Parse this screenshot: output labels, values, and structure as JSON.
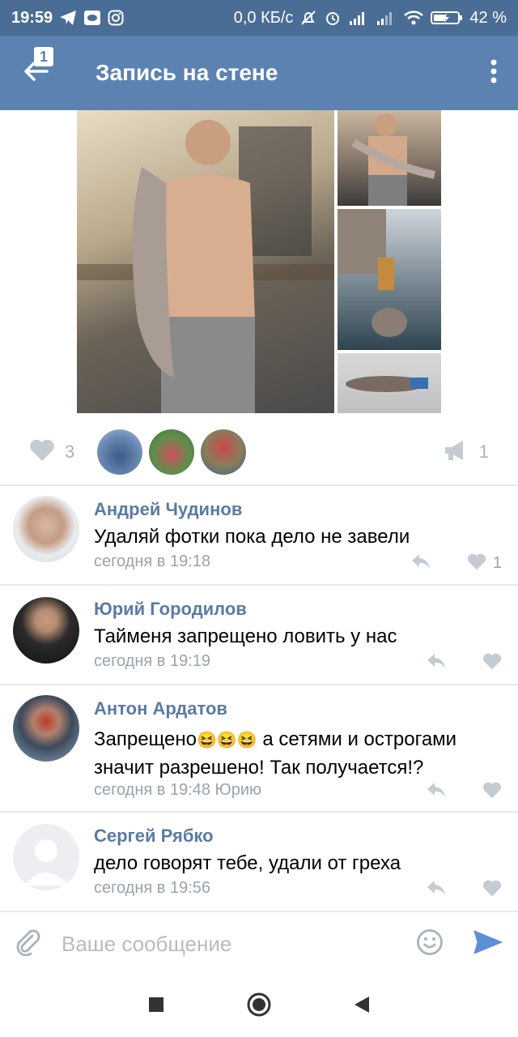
{
  "status_bar": {
    "time": "19:59",
    "network_speed": "0,0 КБ/с",
    "battery": "42 %"
  },
  "toolbar": {
    "badge": "1",
    "title": "Запись на стене"
  },
  "reactions": {
    "likes": "3",
    "shares": "1"
  },
  "comments": [
    {
      "name": "Андрей Чудинов",
      "text": "Удаляй фотки пока дело не завели",
      "time": "сегодня в 19:18",
      "likes": "1"
    },
    {
      "name": "Юрий Городилов",
      "text": "Тайменя запрещено ловить у нас",
      "time": "сегодня в 19:19",
      "likes": ""
    },
    {
      "name": "Антон Ардатов",
      "text_line1": "Запрещено",
      "text_emoji": "😆😆😆",
      "text_line1_tail": " а сетями и острогами",
      "text_line2": "значит разрешено! Так получается!?",
      "time": "сегодня в 19:48 Юрию",
      "likes": ""
    },
    {
      "name": "Сергей Рябко",
      "text": "дело говорят тебе, удали от греха",
      "time": "сегодня в 19:56",
      "likes": ""
    }
  ],
  "composer": {
    "placeholder": "Ваше сообщение"
  },
  "icons": {
    "back": "arrow-left-icon",
    "menu": "more-vertical-icon",
    "like": "heart-icon",
    "share": "megaphone-icon",
    "reply": "reply-icon",
    "attach": "paperclip-icon",
    "emoji": "smiley-icon",
    "send": "send-icon"
  },
  "colors": {
    "toolbar": "#5b82b1",
    "statusbar": "#4a6d96",
    "name": "#5a7ba3",
    "meta": "#9aa3ad",
    "send": "#5b8fd6"
  }
}
